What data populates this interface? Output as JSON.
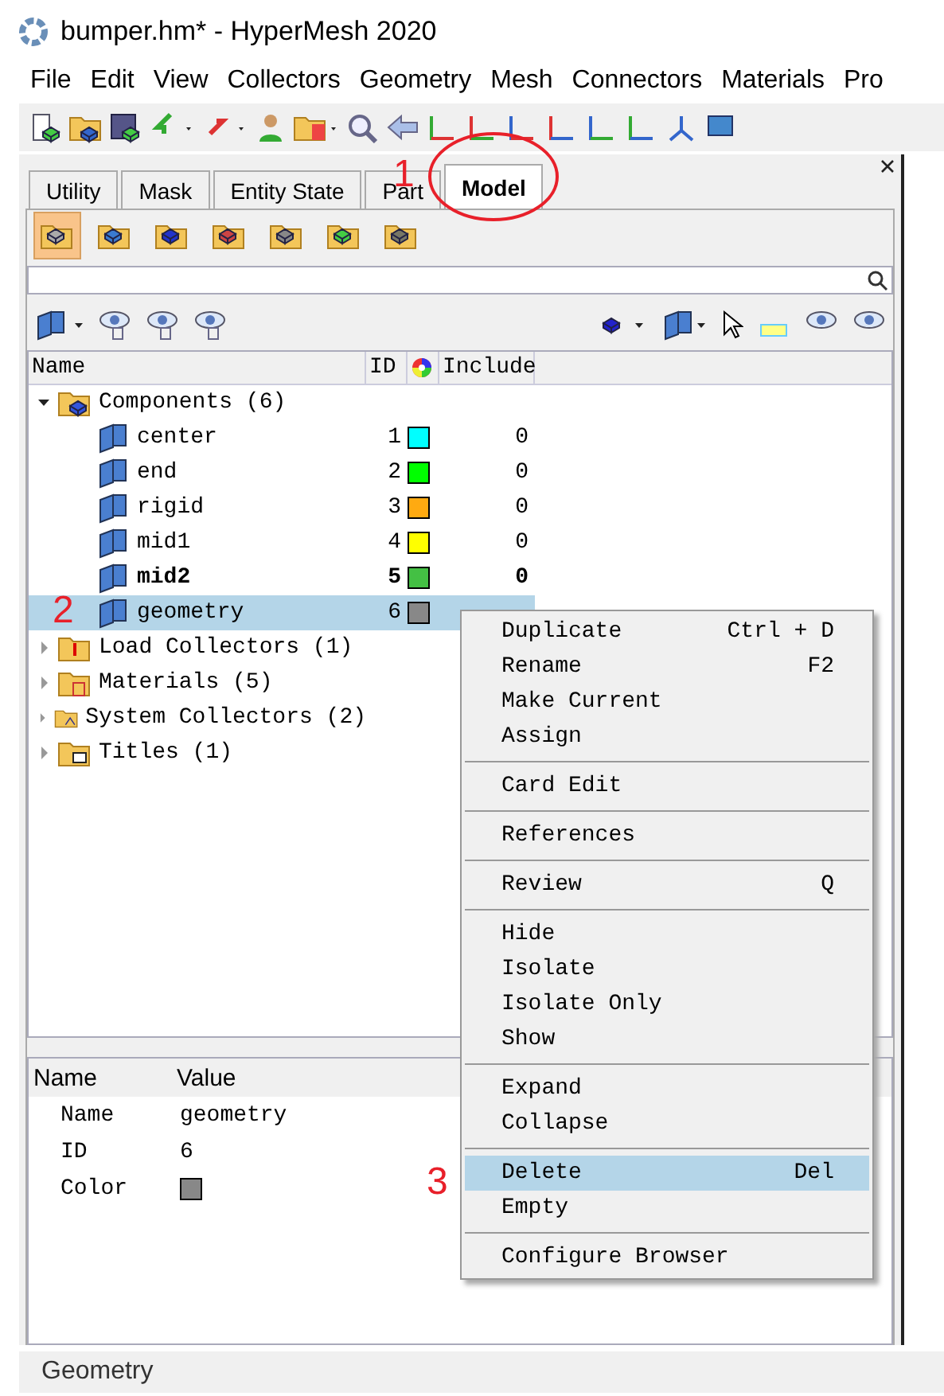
{
  "window": {
    "title": "bumper.hm* - HyperMesh 2020"
  },
  "menu_bar": [
    "File",
    "Edit",
    "View",
    "Collectors",
    "Geometry",
    "Mesh",
    "Connectors",
    "Materials",
    "Pro"
  ],
  "tabs": [
    {
      "label": "Utility",
      "selected": false
    },
    {
      "label": "Mask",
      "selected": false
    },
    {
      "label": "Entity State",
      "selected": false
    },
    {
      "label": "Part",
      "selected": false
    },
    {
      "label": "Model",
      "selected": true
    }
  ],
  "browser_filters": [
    {
      "selected": true
    },
    {
      "selected": false
    },
    {
      "selected": false
    },
    {
      "selected": false
    },
    {
      "selected": false
    },
    {
      "selected": false
    },
    {
      "selected": false
    }
  ],
  "tree": {
    "columns": [
      "Name",
      "ID",
      "Include"
    ],
    "items": [
      {
        "label": "Components (6)",
        "kind": "components",
        "expanded": true,
        "children": [
          {
            "label": "center",
            "id": "1",
            "color": "#00ffff",
            "include": "0",
            "current": false,
            "selected": false
          },
          {
            "label": "end",
            "id": "2",
            "color": "#00ff00",
            "include": "0",
            "current": false,
            "selected": false
          },
          {
            "label": "rigid",
            "id": "3",
            "color": "#ffaa11",
            "include": "0",
            "current": false,
            "selected": false
          },
          {
            "label": "mid1",
            "id": "4",
            "color": "#ffff00",
            "include": "0",
            "current": false,
            "selected": false
          },
          {
            "label": "mid2",
            "id": "5",
            "color": "#44c044",
            "include": "0",
            "current": true,
            "selected": false
          },
          {
            "label": "geometry",
            "id": "6",
            "color": "#888888",
            "current": false,
            "selected": true
          }
        ]
      },
      {
        "label": "Load Collectors (1)",
        "kind": "loads",
        "expanded": false
      },
      {
        "label": "Materials (5)",
        "kind": "materials",
        "expanded": false
      },
      {
        "label": "System Collectors (2)",
        "kind": "systems",
        "expanded": false
      },
      {
        "label": "Titles (1)",
        "kind": "titles",
        "expanded": false
      }
    ]
  },
  "context_menu": {
    "groups": [
      [
        {
          "label": "Duplicate",
          "shortcut": "Ctrl + D",
          "selected": false
        },
        {
          "label": "Rename",
          "shortcut": "F2",
          "selected": false
        },
        {
          "label": "Make Current",
          "selected": false
        },
        {
          "label": "Assign",
          "selected": false
        }
      ],
      [
        {
          "label": "Card Edit",
          "selected": false
        }
      ],
      [
        {
          "label": "References",
          "selected": false
        }
      ],
      [
        {
          "label": "Review",
          "shortcut": "Q",
          "selected": false
        }
      ],
      [
        {
          "label": "Hide",
          "selected": false
        },
        {
          "label": "Isolate",
          "selected": false
        },
        {
          "label": "Isolate Only",
          "selected": false
        },
        {
          "label": "Show",
          "selected": false
        }
      ],
      [
        {
          "label": "Expand",
          "selected": false
        },
        {
          "label": "Collapse",
          "selected": false
        }
      ],
      [
        {
          "label": "Delete",
          "shortcut": "Del",
          "selected": true
        },
        {
          "label": "Empty",
          "selected": false
        }
      ],
      [
        {
          "label": "Configure Browser",
          "selected": false
        }
      ]
    ]
  },
  "properties": {
    "columns": [
      "Name",
      "Value"
    ],
    "rows": [
      {
        "name": "Name",
        "kind": "text",
        "value": "geometry"
      },
      {
        "name": "ID",
        "kind": "text",
        "value": "6"
      },
      {
        "name": "Color",
        "kind": "color",
        "color": "#888888"
      }
    ]
  },
  "status_bar": {
    "text": "Geometry"
  },
  "annotations": [
    "1",
    "2",
    "3"
  ]
}
